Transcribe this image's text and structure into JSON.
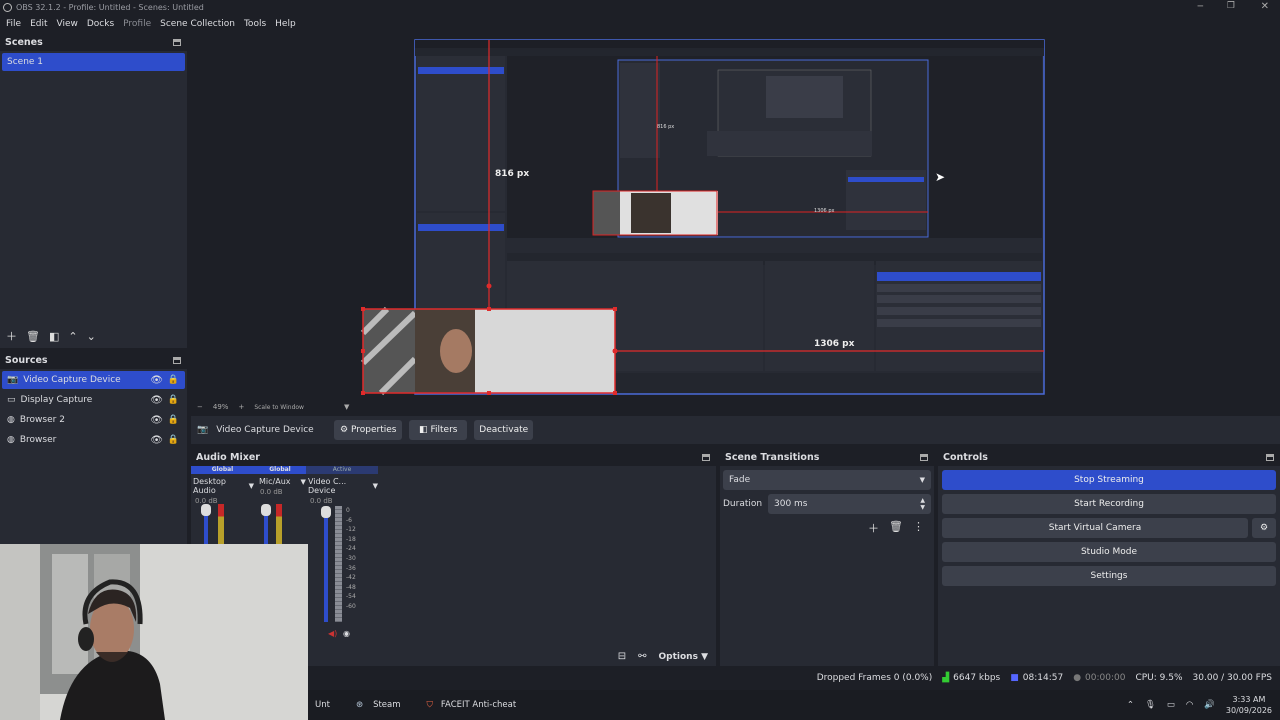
{
  "window": {
    "title": "OBS 32.1.2 - Profile: Untitled - Scenes: Untitled"
  },
  "menu": [
    "File",
    "Edit",
    "View",
    "Docks",
    "Profile",
    "Scene Collection",
    "Tools",
    "Help"
  ],
  "scenes": {
    "title": "Scenes",
    "items": [
      "Scene 1"
    ]
  },
  "sources": {
    "title": "Sources",
    "items": [
      "Video Capture Device",
      "Display Capture",
      "Browser 2",
      "Browser"
    ]
  },
  "preview": {
    "measure_vertical": "816 px",
    "measure_horizontal": "1306 px",
    "zoom": "49%",
    "scale_mode": "Scale to Window"
  },
  "source_toolbar": {
    "source_name": "Video Capture Device",
    "properties": "Properties",
    "filters": "Filters",
    "deactivate": "Deactivate"
  },
  "audio_mixer": {
    "title": "Audio Mixer",
    "channels": [
      {
        "tag": "Global",
        "name": "Desktop Audio",
        "db": "0.0 dB"
      },
      {
        "tag": "Global",
        "name": "Mic/Aux",
        "db": "0.0 dB"
      },
      {
        "tag": "Active",
        "name": "Video C... Device",
        "db": "0.0 dB"
      }
    ],
    "scale": [
      "0",
      "-6",
      "-12",
      "-18",
      "-24",
      "-30",
      "-36",
      "-42",
      "-48",
      "-54",
      "-60"
    ],
    "options": "Options"
  },
  "scene_transitions": {
    "title": "Scene Transitions",
    "transition": "Fade",
    "duration_label": "Duration",
    "duration_value": "300 ms"
  },
  "controls": {
    "title": "Controls",
    "stop_streaming": "Stop Streaming",
    "start_recording": "Start Recording",
    "start_virtual_camera": "Start Virtual Camera",
    "studio_mode": "Studio Mode",
    "settings": "Settings"
  },
  "status": {
    "dropped_frames": "Dropped Frames 0 (0.0%)",
    "bitrate": "6647 kbps",
    "stream_time": "08:14:57",
    "record_time": "00:00:00",
    "cpu": "CPU: 9.5%",
    "fps": "30.00 / 30.00 FPS"
  },
  "taskbar": {
    "items": [
      "Unt",
      "Steam",
      "FACEIT Anti-cheat"
    ],
    "time": "3:33 AM",
    "date": "30/09/2026"
  },
  "colors": {
    "accent": "#2e4dcb",
    "panel": "#272a33",
    "background": "#1d1f26",
    "selection": "#e02b2b"
  }
}
